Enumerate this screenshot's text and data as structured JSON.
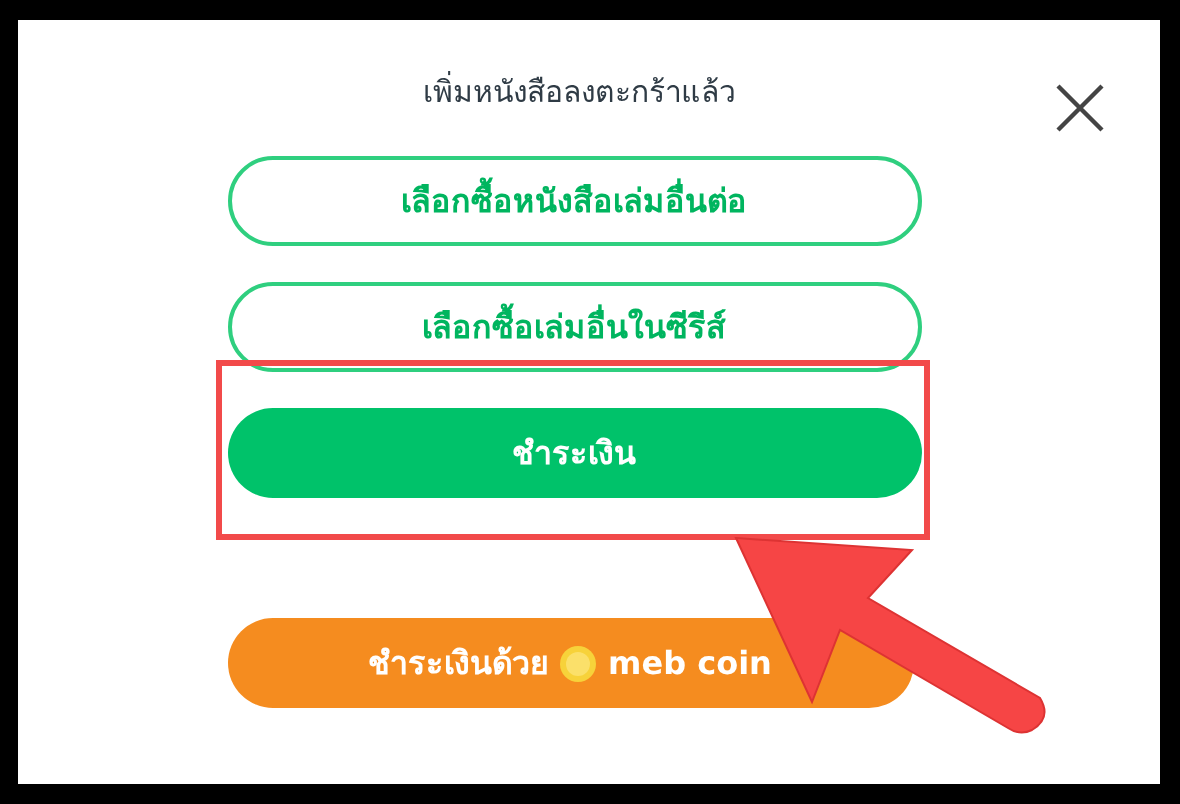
{
  "dialog": {
    "title": "เพิ่มหนังสือลงตะกร้าแล้ว"
  },
  "actions": [
    {
      "label": "เลือกซื้อหนังสือเล่มอื่นต่อ",
      "kind": "outline",
      "highlighted": false
    },
    {
      "label": "เลือกซื้อเล่มอื่นในซีรีส์",
      "kind": "outline",
      "highlighted": false
    },
    {
      "label": "ชำระเงิน",
      "kind": "filled",
      "highlighted": true
    },
    {
      "label": "ชำระเงินด้วย",
      "suffix": "meb coin",
      "kind": "coin",
      "highlighted": false
    }
  ]
}
